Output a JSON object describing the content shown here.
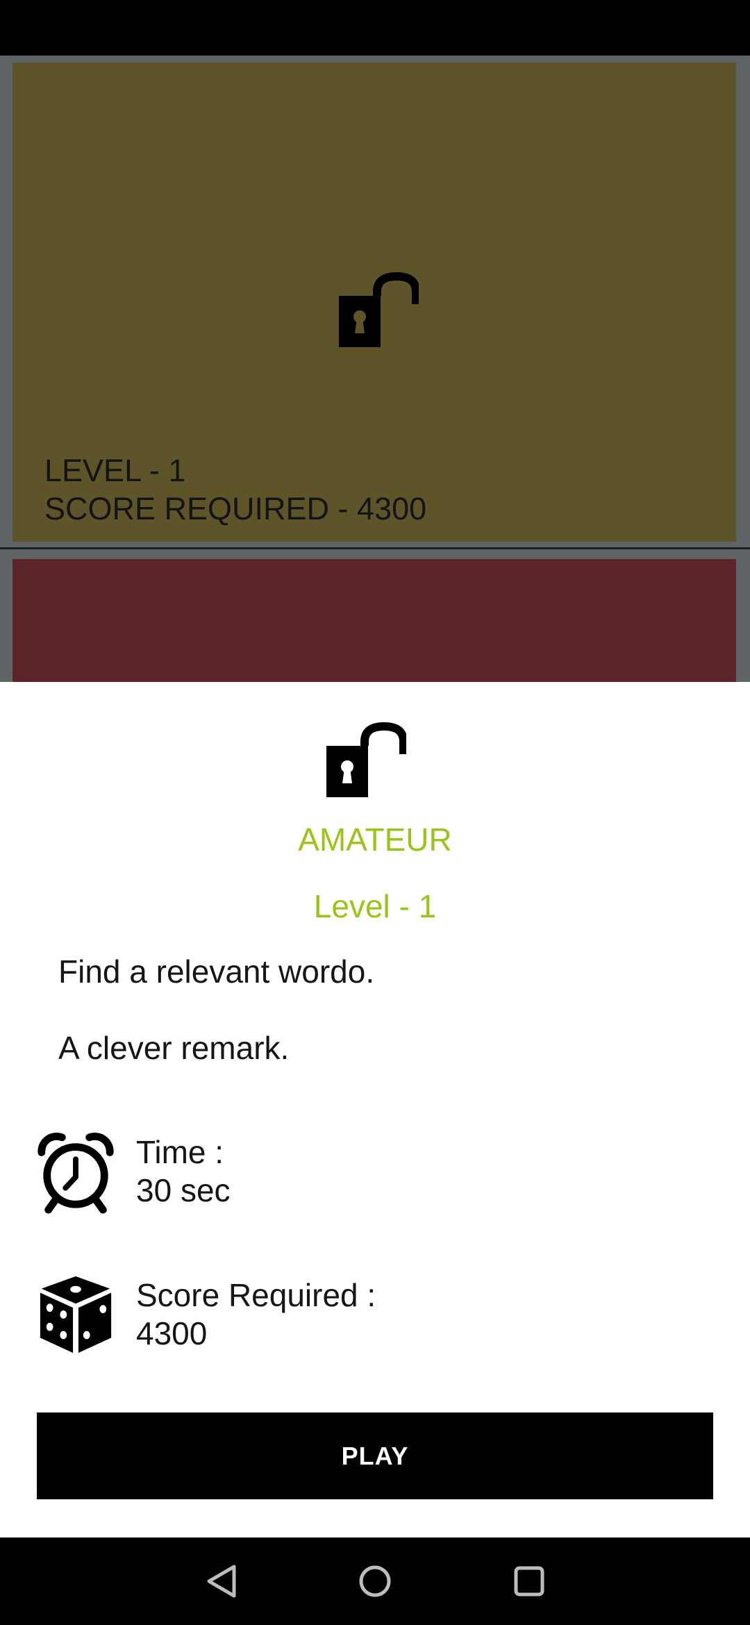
{
  "level_card": {
    "level": "LEVEL - 1",
    "score_required": "SCORE REQUIRED - 4300"
  },
  "sheet": {
    "category": "AMATEUR",
    "level": "Level - 1",
    "description_1": "Find a relevant wordo.",
    "description_2": "A clever remark.",
    "time_label": "Time :",
    "time_value": "30 sec",
    "score_label": "Score Required :",
    "score_value": "4300",
    "play_label": "PLAY"
  },
  "icons": [
    "unlock-icon",
    "alarm-clock-icon",
    "dice-icon",
    "back-icon",
    "home-icon",
    "recents-icon"
  ],
  "colors": {
    "accent": "#9bc41b",
    "card_yellow": "#5e542a",
    "card_red": "#5c2428",
    "button": "#000000"
  }
}
